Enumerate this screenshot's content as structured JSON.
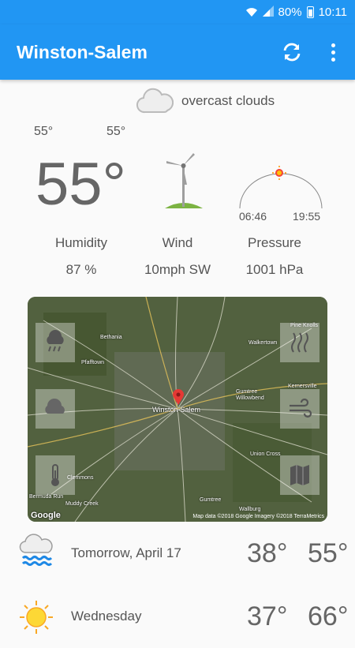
{
  "status": {
    "battery": "80%",
    "time": "10:11"
  },
  "app": {
    "title": "Winston-Salem"
  },
  "current": {
    "condition": "overcast clouds",
    "min_temp": "55°",
    "max_temp": "55°",
    "temp": "55°",
    "sunrise": "06:46",
    "sunset": "19:55",
    "humidity_label": "Humidity",
    "humidity_value": "87 %",
    "wind_label": "Wind",
    "wind_value": "10mph SW",
    "pressure_label": "Pressure",
    "pressure_value": "1001 hPa"
  },
  "map": {
    "places": [
      "Bethania",
      "Pfafftown",
      "Walkertown",
      "Pine Knolls",
      "Winston-Salem",
      "Kernersville",
      "Gumtree",
      "Willowbend",
      "Union Cross",
      "Clemmons",
      "Bermuda Run",
      "Muddy Creek",
      "Gumtree",
      "Wallburg"
    ],
    "logo": "Google",
    "attribution": "Map data ©2018 Google  Imagery ©2018 TerraMetrics"
  },
  "forecast": [
    {
      "day": "Tomorrow, April 17",
      "low": "38°",
      "high": "55°",
      "icon": "rain-icon"
    },
    {
      "day": "Wednesday",
      "low": "37°",
      "high": "66°",
      "icon": "sun-icon"
    }
  ],
  "colors": {
    "primary": "#2196f3",
    "background": "#fafafa"
  }
}
